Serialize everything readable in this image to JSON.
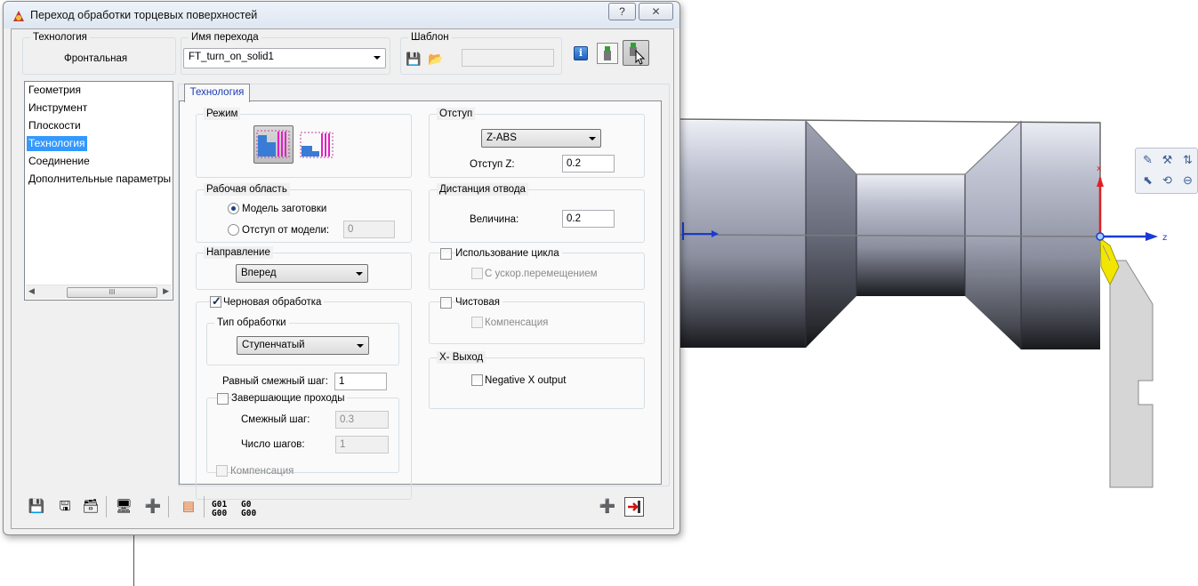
{
  "dialog": {
    "title": "Переход обработки торцевых поверхностей",
    "help_label": "?",
    "close_label": "✕"
  },
  "header": {
    "technology_label": "Технология",
    "technology_value": "Фронтальная",
    "step_name_label": "Имя перехода",
    "step_name_value": "FT_turn_on_solid1",
    "template_label": "Шаблон",
    "template_value": ""
  },
  "sidebar": {
    "items": [
      {
        "label": "Геометрия",
        "selected": false
      },
      {
        "label": "Инструмент",
        "selected": false
      },
      {
        "label": "Плоскости",
        "selected": false
      },
      {
        "label": "Технология",
        "selected": true
      },
      {
        "label": "Соединение",
        "selected": false
      },
      {
        "label": "Дополнительные параметры",
        "selected": false
      }
    ],
    "scroll_grip": "III"
  },
  "tab": {
    "label": "Технология"
  },
  "left": {
    "mode_label": "Режим",
    "work_area_label": "Рабочая область",
    "model_blank_label": "Модель заготовки",
    "offset_from_model_label": "Отступ от модели:",
    "offset_from_model_value": "0",
    "direction_label": "Направление",
    "direction_value": "Вперед",
    "rough_label": "Черновая обработка",
    "rough_checked": true,
    "processing_type_label": "Тип обработки",
    "processing_type_value": "Ступенчатый",
    "equal_step_label": "Равный смежный шаг:",
    "equal_step_value": "1",
    "finishing_passes_label": "Завершающие проходы",
    "adjacent_step_label": "Смежный шаг:",
    "adjacent_step_value": "0.3",
    "step_count_label": "Число шагов:",
    "step_count_value": "1",
    "compensation_label": "Компенсация"
  },
  "right": {
    "offset_label": "Отступ",
    "offset_mode_value": "Z-ABS",
    "offset_z_label": "Отступ Z:",
    "offset_z_value": "0.2",
    "retract_label": "Дистанция отвода",
    "magnitude_label": "Величина:",
    "magnitude_value": "0.2",
    "use_cycle_label": "Использование цикла",
    "rapid_label": "С ускор.перемещением",
    "finish_label": "Чистовая",
    "finish_comp_label": "Компенсация",
    "x_exit_label": "X- Выход",
    "negative_x_label": "Negative X output"
  },
  "bottom_toolbar": {
    "gcode1": [
      "G01",
      "G00"
    ],
    "gcode2": [
      "G0",
      "G00"
    ]
  },
  "cad": {
    "axis_x_label": "x",
    "axis_z_label": "z"
  },
  "colors": {
    "selection": "#3399ff",
    "tab_text": "#1a3bb3",
    "axis_red": "#e02020",
    "axis_blue": "#1a3ad8",
    "tool_yellow": "#f2e600"
  }
}
